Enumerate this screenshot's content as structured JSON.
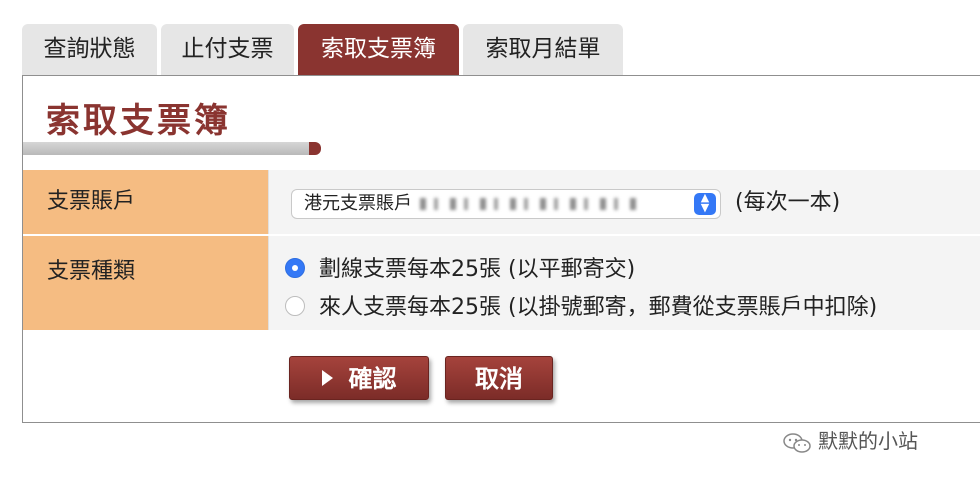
{
  "tabs": [
    {
      "label": "查詢狀態",
      "active": false
    },
    {
      "label": "止付支票",
      "active": false
    },
    {
      "label": "索取支票簿",
      "active": true
    },
    {
      "label": "索取月結單",
      "active": false
    }
  ],
  "page_title": "索取支票簿",
  "form": {
    "account_label": "支票賬戶",
    "account_select_value": "港元支票賬戶",
    "per_book_note": "(每次一本)",
    "type_label": "支票種類",
    "options": [
      {
        "label": "劃線支票每本25張 (以平郵寄交)",
        "selected": true
      },
      {
        "label": "來人支票每本25張 (以掛號郵寄，郵費從支票賬戶中扣除)",
        "selected": false
      }
    ]
  },
  "buttons": {
    "confirm_label": "確認",
    "cancel_label": "取消"
  },
  "watermark": "默默的小站",
  "colors": {
    "brand": "#8a3430",
    "label_bg": "#f5bc82",
    "radio_accent": "#3478f6"
  }
}
